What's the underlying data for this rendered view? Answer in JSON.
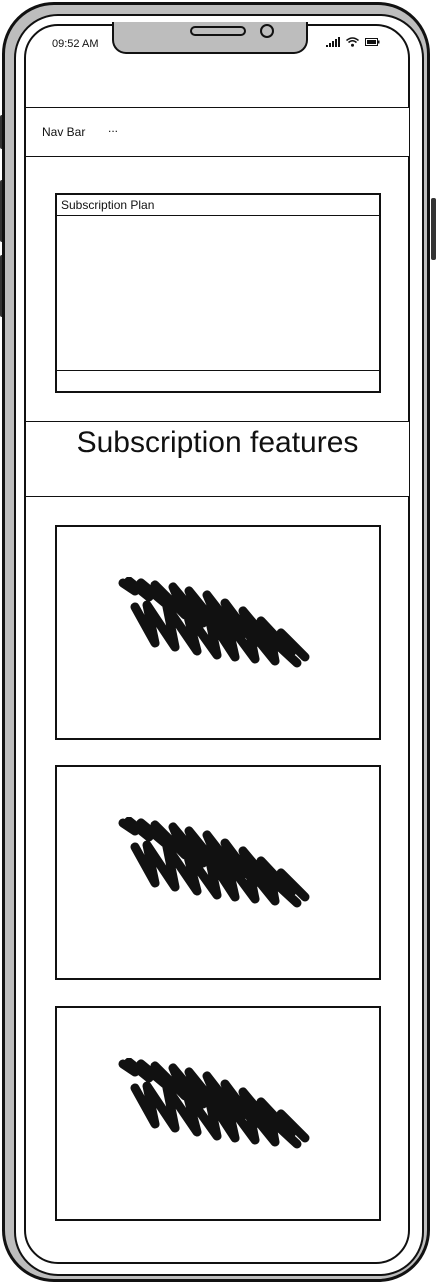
{
  "status_bar": {
    "time": "09:52 AM",
    "icons": [
      "signal-icon",
      "wifi-icon",
      "battery-icon"
    ]
  },
  "nav_bar": {
    "title": "Nav Bar",
    "menu_dots": "..."
  },
  "subscription_plan": {
    "title": "Subscription Plan"
  },
  "features": {
    "heading": "Subscription features",
    "cards": [
      {
        "image": "image-placeholder-icon"
      },
      {
        "image": "image-placeholder-icon"
      },
      {
        "image": "image-placeholder-icon"
      }
    ]
  }
}
